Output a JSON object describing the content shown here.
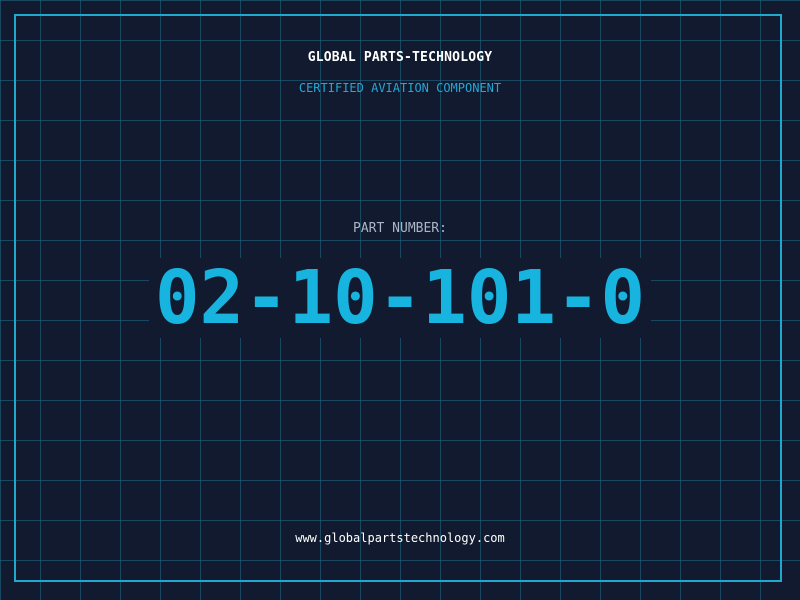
{
  "header": {
    "company_name": "GLOBAL PARTS-TECHNOLOGY",
    "tagline": "CERTIFIED AVIATION COMPONENT"
  },
  "part": {
    "label": "PART NUMBER:",
    "number": "02-10-101-0"
  },
  "footer": {
    "website": "www.globalpartstechnology.com"
  },
  "colors": {
    "background": "#111a2e",
    "grid": "#1e6e8c",
    "accent": "#18b4e0",
    "border": "#1fa9cf",
    "title_text": "#ffffff",
    "label_text": "#a9b6c6"
  }
}
